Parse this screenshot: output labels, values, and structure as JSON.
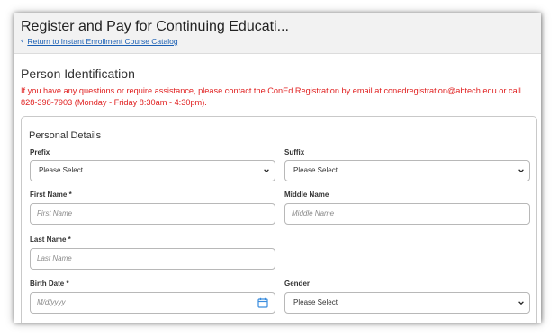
{
  "header": {
    "title": "Register and Pay for Continuing Educati...",
    "back_link": "Return to Instant Enrollment Course Catalog"
  },
  "page": {
    "section_title": "Person Identification",
    "notice": "If you have any questions or require assistance, please contact the ConEd Registration by email at conedregistration@abtech.edu or call 828-398-7903 (Monday - Friday 8:30am - 4:30pm)."
  },
  "personal_details": {
    "title": "Personal Details",
    "prefix": {
      "label": "Prefix",
      "value": "Please Select"
    },
    "suffix": {
      "label": "Suffix",
      "value": "Please Select"
    },
    "first_name": {
      "label": "First Name *",
      "placeholder": "First Name"
    },
    "middle_name": {
      "label": "Middle Name",
      "placeholder": "Middle Name"
    },
    "last_name": {
      "label": "Last Name *",
      "placeholder": "Last Name"
    },
    "birth_date": {
      "label": "Birth Date *",
      "placeholder": "M/d/yyyy"
    },
    "gender": {
      "label": "Gender",
      "value": "Please Select"
    }
  },
  "colors": {
    "notice": "#e02020",
    "link": "#1a5fb4",
    "calendar_icon": "#3a8dde",
    "header_bg": "#f2f2f2"
  },
  "icons": {
    "back": "chevron-left-icon",
    "dropdown": "chevron-down-icon",
    "date_picker": "calendar-icon"
  }
}
